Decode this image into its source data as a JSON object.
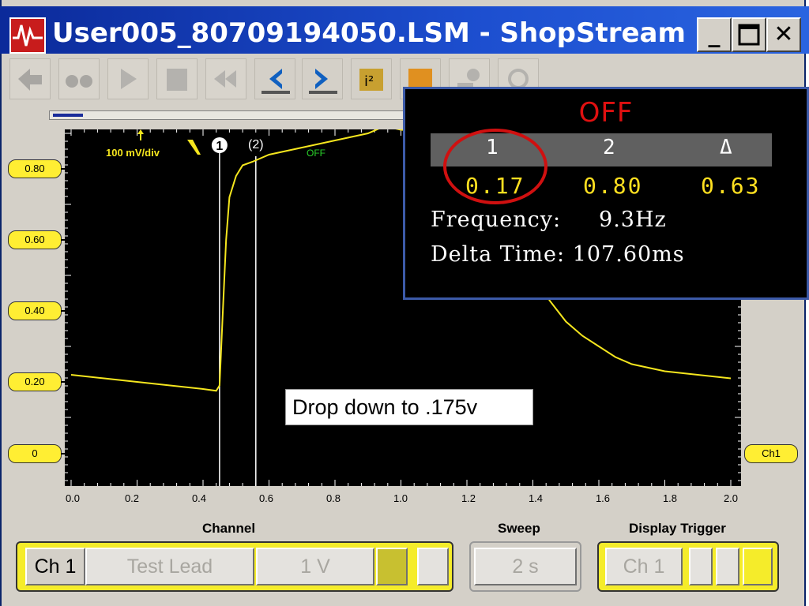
{
  "window": {
    "title": "User005_80709194050.LSM - ShopStream ...",
    "minimize": "_",
    "close": "✕"
  },
  "toolbar": {
    "icons": [
      "back-icon",
      "binoculars-icon",
      "play-icon",
      "waveform-library-icon",
      "rewind-icon",
      "cursor-left-icon",
      "cursor-right-icon",
      "cursor-info-icon",
      "multimeter-icon",
      "probe-icon",
      "refresh-icon"
    ]
  },
  "plot": {
    "scale_label": "100 mV/div",
    "cursor1_label": "1",
    "cursor2_label": "(2)",
    "trigger_label": "OFF",
    "y_labels": [
      "0.80",
      "0.60",
      "0.40",
      "0.20",
      "0"
    ],
    "x_labels": [
      "0.0",
      "0.2",
      "0.4",
      "0.6",
      "0.8",
      "1.0",
      "1.2",
      "1.4",
      "1.6",
      "1.8",
      "2.0"
    ],
    "channel_tag": "Ch1",
    "trace_color": "#f5e61e"
  },
  "chart_data": {
    "type": "line",
    "xlim": [
      0,
      2.0
    ],
    "ylim": [
      0,
      1.0
    ],
    "cursors": [
      0.45,
      0.56
    ],
    "series": [
      {
        "x": [
          0.0,
          0.1,
          0.2,
          0.3,
          0.4,
          0.44,
          0.45,
          0.46,
          0.47,
          0.48,
          0.5,
          0.52,
          0.55,
          0.6,
          0.7,
          0.8,
          0.9,
          0.95,
          1.0,
          1.1,
          1.2,
          1.3,
          1.4,
          1.42,
          1.45,
          1.5,
          1.55,
          1.6,
          1.65,
          1.7,
          1.8,
          1.9,
          2.0
        ],
        "values": [
          0.22,
          0.21,
          0.2,
          0.19,
          0.18,
          0.175,
          0.19,
          0.4,
          0.6,
          0.72,
          0.78,
          0.81,
          0.82,
          0.84,
          0.86,
          0.88,
          0.9,
          0.92,
          0.91,
          0.9,
          0.88,
          0.85,
          0.72,
          0.55,
          0.43,
          0.37,
          0.33,
          0.3,
          0.27,
          0.25,
          0.23,
          0.22,
          0.21
        ]
      }
    ]
  },
  "readout": {
    "status": "OFF",
    "col1": "1",
    "col2": "2",
    "col3": "Δ",
    "val1": "0.17",
    "val2": "0.80",
    "val3": "0.63",
    "frequency": "Frequency:     9.3Hz",
    "delta_time": "Delta Time: 107.60ms"
  },
  "callout": "Drop down to .175v",
  "controls": {
    "channel_label": "Channel",
    "sweep_label": "Sweep",
    "trigger_label": "Display Trigger",
    "channel": "Ch 1",
    "lead": "Test Lead",
    "volts": "1 V",
    "sweep": "2 s",
    "trigger_channel": "Ch 1"
  }
}
